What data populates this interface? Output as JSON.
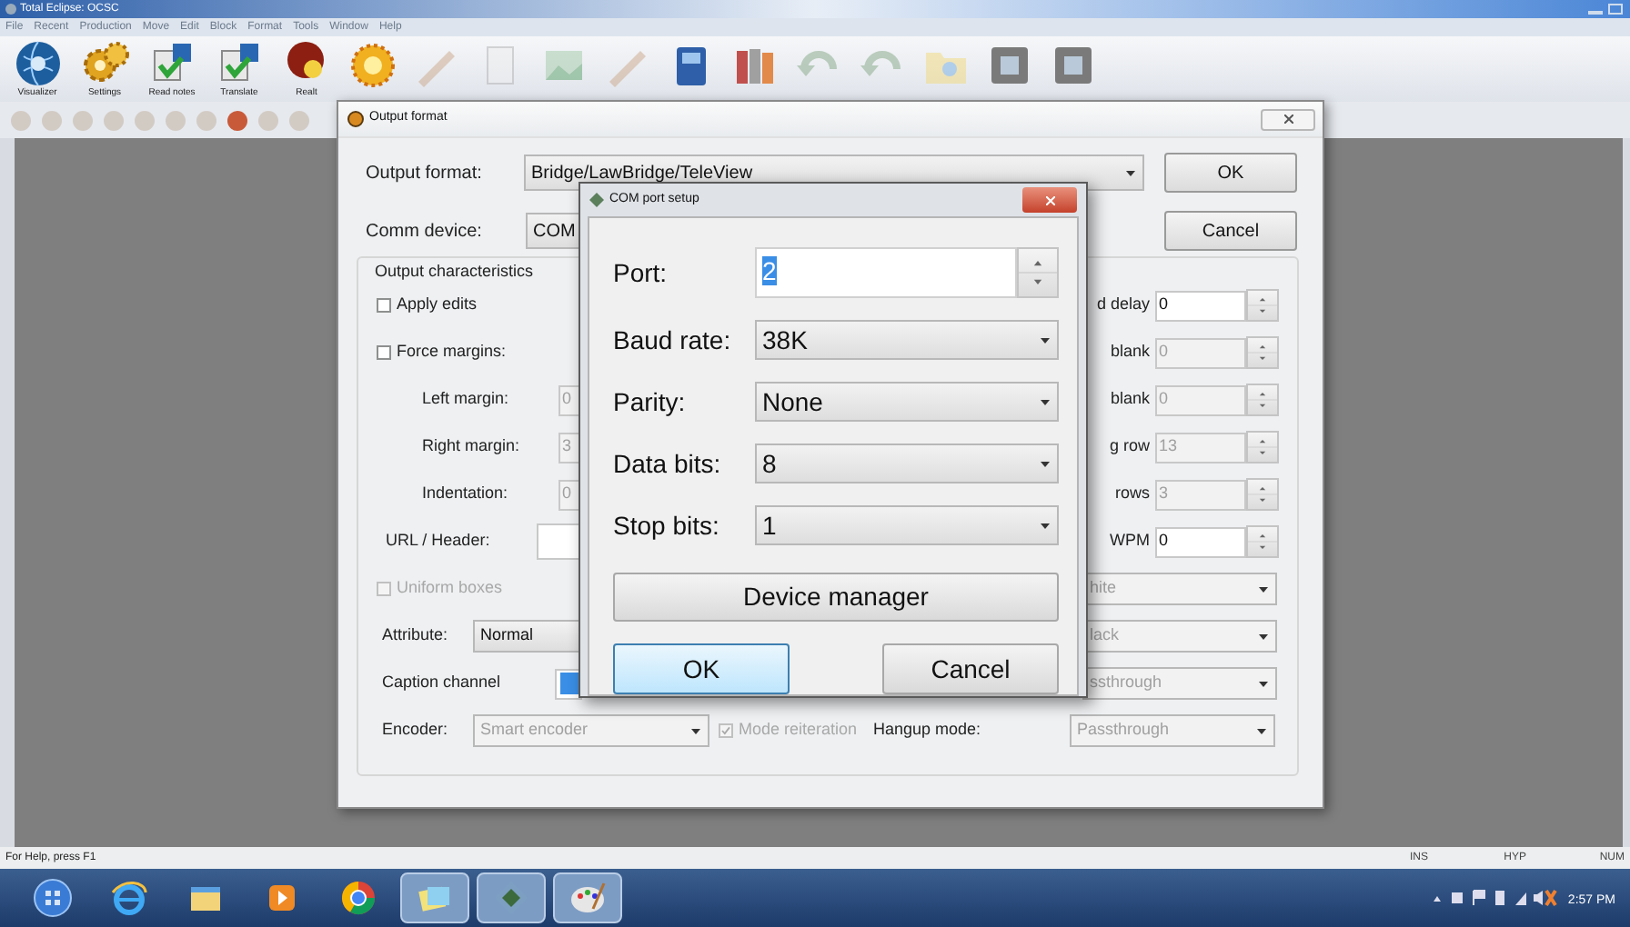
{
  "app": {
    "title": "Total Eclipse: OCSC",
    "menu": [
      "File",
      "Recent",
      "Production",
      "Move",
      "Edit",
      "Block",
      "Format",
      "Tools",
      "Window",
      "Help"
    ],
    "toolbar": [
      {
        "kind": "globe",
        "label": "Visualizer"
      },
      {
        "kind": "gears",
        "label": "Settings"
      },
      {
        "kind": "page",
        "label": "Read notes"
      },
      {
        "kind": "page",
        "label": "Translate"
      },
      {
        "kind": "bulb",
        "label": "Realt"
      }
    ],
    "status_bar": {
      "help": "For Help, press F1",
      "indicators": [
        "INS",
        "HYP",
        "NUM"
      ]
    }
  },
  "output_dialog": {
    "title": "Output format",
    "top_rows": [
      {
        "label": "Output format:",
        "value": "Bridge/LawBridge/TeleView"
      },
      {
        "label": "Comm device:",
        "value": "COM"
      }
    ],
    "buttons": [
      "OK",
      "Cancel"
    ],
    "group_title": "Output characteristics",
    "left_rows": [
      {
        "kind": "checkbox",
        "label": "Apply edits",
        "checked": false,
        "disabled": false
      },
      {
        "kind": "checkbox",
        "label": "Force margins:",
        "checked": false,
        "disabled": false
      },
      {
        "kind": "field",
        "label": "Left margin:",
        "value": "0",
        "disabled": true
      },
      {
        "kind": "field",
        "label": "Right margin:",
        "value": "3",
        "disabled": true
      },
      {
        "kind": "field",
        "label": "Indentation:",
        "value": "0",
        "disabled": true
      },
      {
        "kind": "input",
        "label": "URL / Header:"
      },
      {
        "kind": "checkbox",
        "label": "Uniform boxes",
        "checked": false,
        "disabled": true
      },
      {
        "kind": "combo",
        "label": "Attribute:",
        "value": "Normal",
        "disabled": false
      },
      {
        "kind": "selection",
        "label": "Caption channel"
      }
    ],
    "right_rows": [
      {
        "kind": "spin",
        "label": "d delay",
        "value": "0",
        "disabled": false
      },
      {
        "kind": "spin",
        "label": "blank",
        "value": "0",
        "disabled": true
      },
      {
        "kind": "spin",
        "label": "blank",
        "value": "0",
        "disabled": true
      },
      {
        "kind": "spin",
        "label": "g row",
        "value": "13",
        "disabled": true
      },
      {
        "kind": "spin",
        "label": "rows",
        "value": "3",
        "disabled": true
      },
      {
        "kind": "spin",
        "label": "WPM",
        "value": "0",
        "disabled": false
      },
      {
        "kind": "combo",
        "value": "hite",
        "disabled": true
      },
      {
        "kind": "combo",
        "value": "lack",
        "disabled": true
      },
      {
        "kind": "combo",
        "value": "ssthrough",
        "disabled": true
      }
    ],
    "encoder": {
      "label": "Encoder:",
      "value": "Smart encoder",
      "disabled": true
    },
    "mode_reiteration": {
      "label": "Mode reiteration",
      "checked": true,
      "disabled": true
    },
    "hangup": {
      "label": "Hangup mode:",
      "value": "Passthrough",
      "disabled": true
    }
  },
  "com_dialog": {
    "title": "COM port setup",
    "fields": [
      {
        "kind": "spin",
        "label": "Port:",
        "value": "2"
      },
      {
        "kind": "combo",
        "label": "Baud rate:",
        "value": "38K"
      },
      {
        "kind": "combo",
        "label": "Parity:",
        "value": "None"
      },
      {
        "kind": "combo",
        "label": "Data bits:",
        "value": "8"
      },
      {
        "kind": "combo",
        "label": "Stop bits:",
        "value": "1"
      }
    ],
    "device_button": "Device manager",
    "buttons": [
      {
        "label": "OK",
        "default": true
      },
      {
        "label": "Cancel",
        "default": false
      }
    ]
  },
  "taskbar": {
    "apps": [
      {
        "kind": "orb",
        "running": false
      },
      {
        "kind": "globe",
        "running": false
      },
      {
        "kind": "folder",
        "running": false
      },
      {
        "kind": "player",
        "running": false
      },
      {
        "kind": "wheel",
        "running": false
      },
      {
        "kind": "notes",
        "running": true
      },
      {
        "kind": "diamond",
        "running": true
      },
      {
        "kind": "palette",
        "running": true
      }
    ],
    "clock": "2:57 PM"
  }
}
